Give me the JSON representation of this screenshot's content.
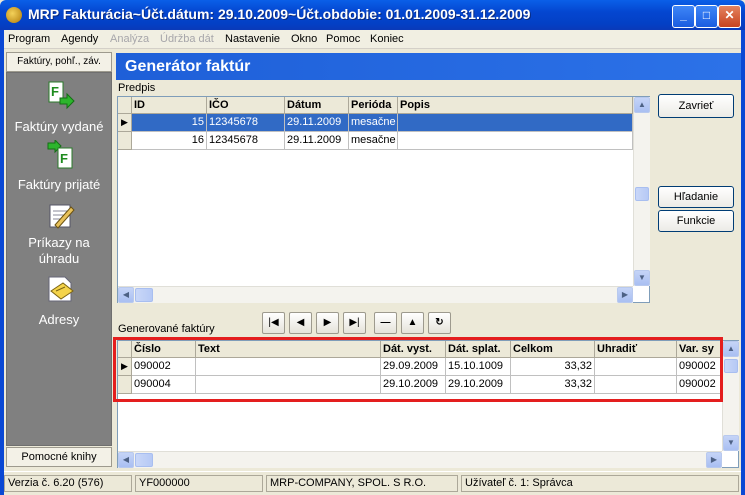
{
  "window": {
    "title": "MRP Fakturácia~Účt.dátum: 29.10.2009~Účt.obdobie: 01.01.2009-31.12.2009"
  },
  "menu": [
    {
      "label": "Program",
      "enabled": true
    },
    {
      "label": "Agendy",
      "enabled": true
    },
    {
      "label": "Analýza",
      "enabled": false
    },
    {
      "label": "Údržba dát",
      "enabled": false
    },
    {
      "label": "Nastavenie",
      "enabled": true
    },
    {
      "label": "Okno",
      "enabled": true
    },
    {
      "label": "Pomoc",
      "enabled": true
    },
    {
      "label": "Koniec",
      "enabled": true
    }
  ],
  "left_panel": {
    "tab_label": "Faktúry, pohľ., záv.",
    "items": [
      {
        "label": "Faktúry vydané",
        "icon": "invoice-issued-icon"
      },
      {
        "label": "Faktúry prijaté",
        "icon": "invoice-received-icon"
      },
      {
        "label": "Príkazy na úhradu",
        "icon": "payment-order-icon"
      },
      {
        "label": "Adresy",
        "icon": "address-icon"
      }
    ],
    "bottom_label": "Pomocné knihy"
  },
  "page": {
    "title": "Generátor faktúr"
  },
  "predpis": {
    "label": "Predpis",
    "columns": [
      "ID",
      "IČO",
      "Dátum",
      "Perióda",
      "Popis"
    ],
    "rows": [
      {
        "id": "15",
        "ico": "12345678",
        "datum": "29.11.2009",
        "perioda": "mesačne",
        "popis": "",
        "selected": true
      },
      {
        "id": "16",
        "ico": "12345678",
        "datum": "29.11.2009",
        "perioda": "mesačne",
        "popis": "",
        "selected": false
      }
    ]
  },
  "buttons": {
    "close": "Zavrieť",
    "search": "Hľadanie",
    "functions": "Funkcie"
  },
  "generated": {
    "label": "Generované faktúry",
    "columns": [
      "Číslo",
      "Text",
      "Dát. vyst.",
      "Dát. splat.",
      "Celkom",
      "Uhradiť",
      "Var. sy"
    ],
    "rows": [
      {
        "cislo": "090002",
        "text": "",
        "dat_vyst": "29.09.2009",
        "dat_splat": "15.10.1009",
        "celkom": "33,32",
        "uhradit": "",
        "var_sym": "090002"
      },
      {
        "cislo": "090004",
        "text": "",
        "dat_vyst": "29.10.2009",
        "dat_splat": "29.10.2009",
        "celkom": "33,32",
        "uhradit": "",
        "var_sym": "090002"
      }
    ]
  },
  "status": {
    "version": "Verzia č. 6.20 (576)",
    "code": "YF000000",
    "company": "MRP-COMPANY, SPOL. S R.O.",
    "user": "Užívateľ č. 1: Správca"
  }
}
